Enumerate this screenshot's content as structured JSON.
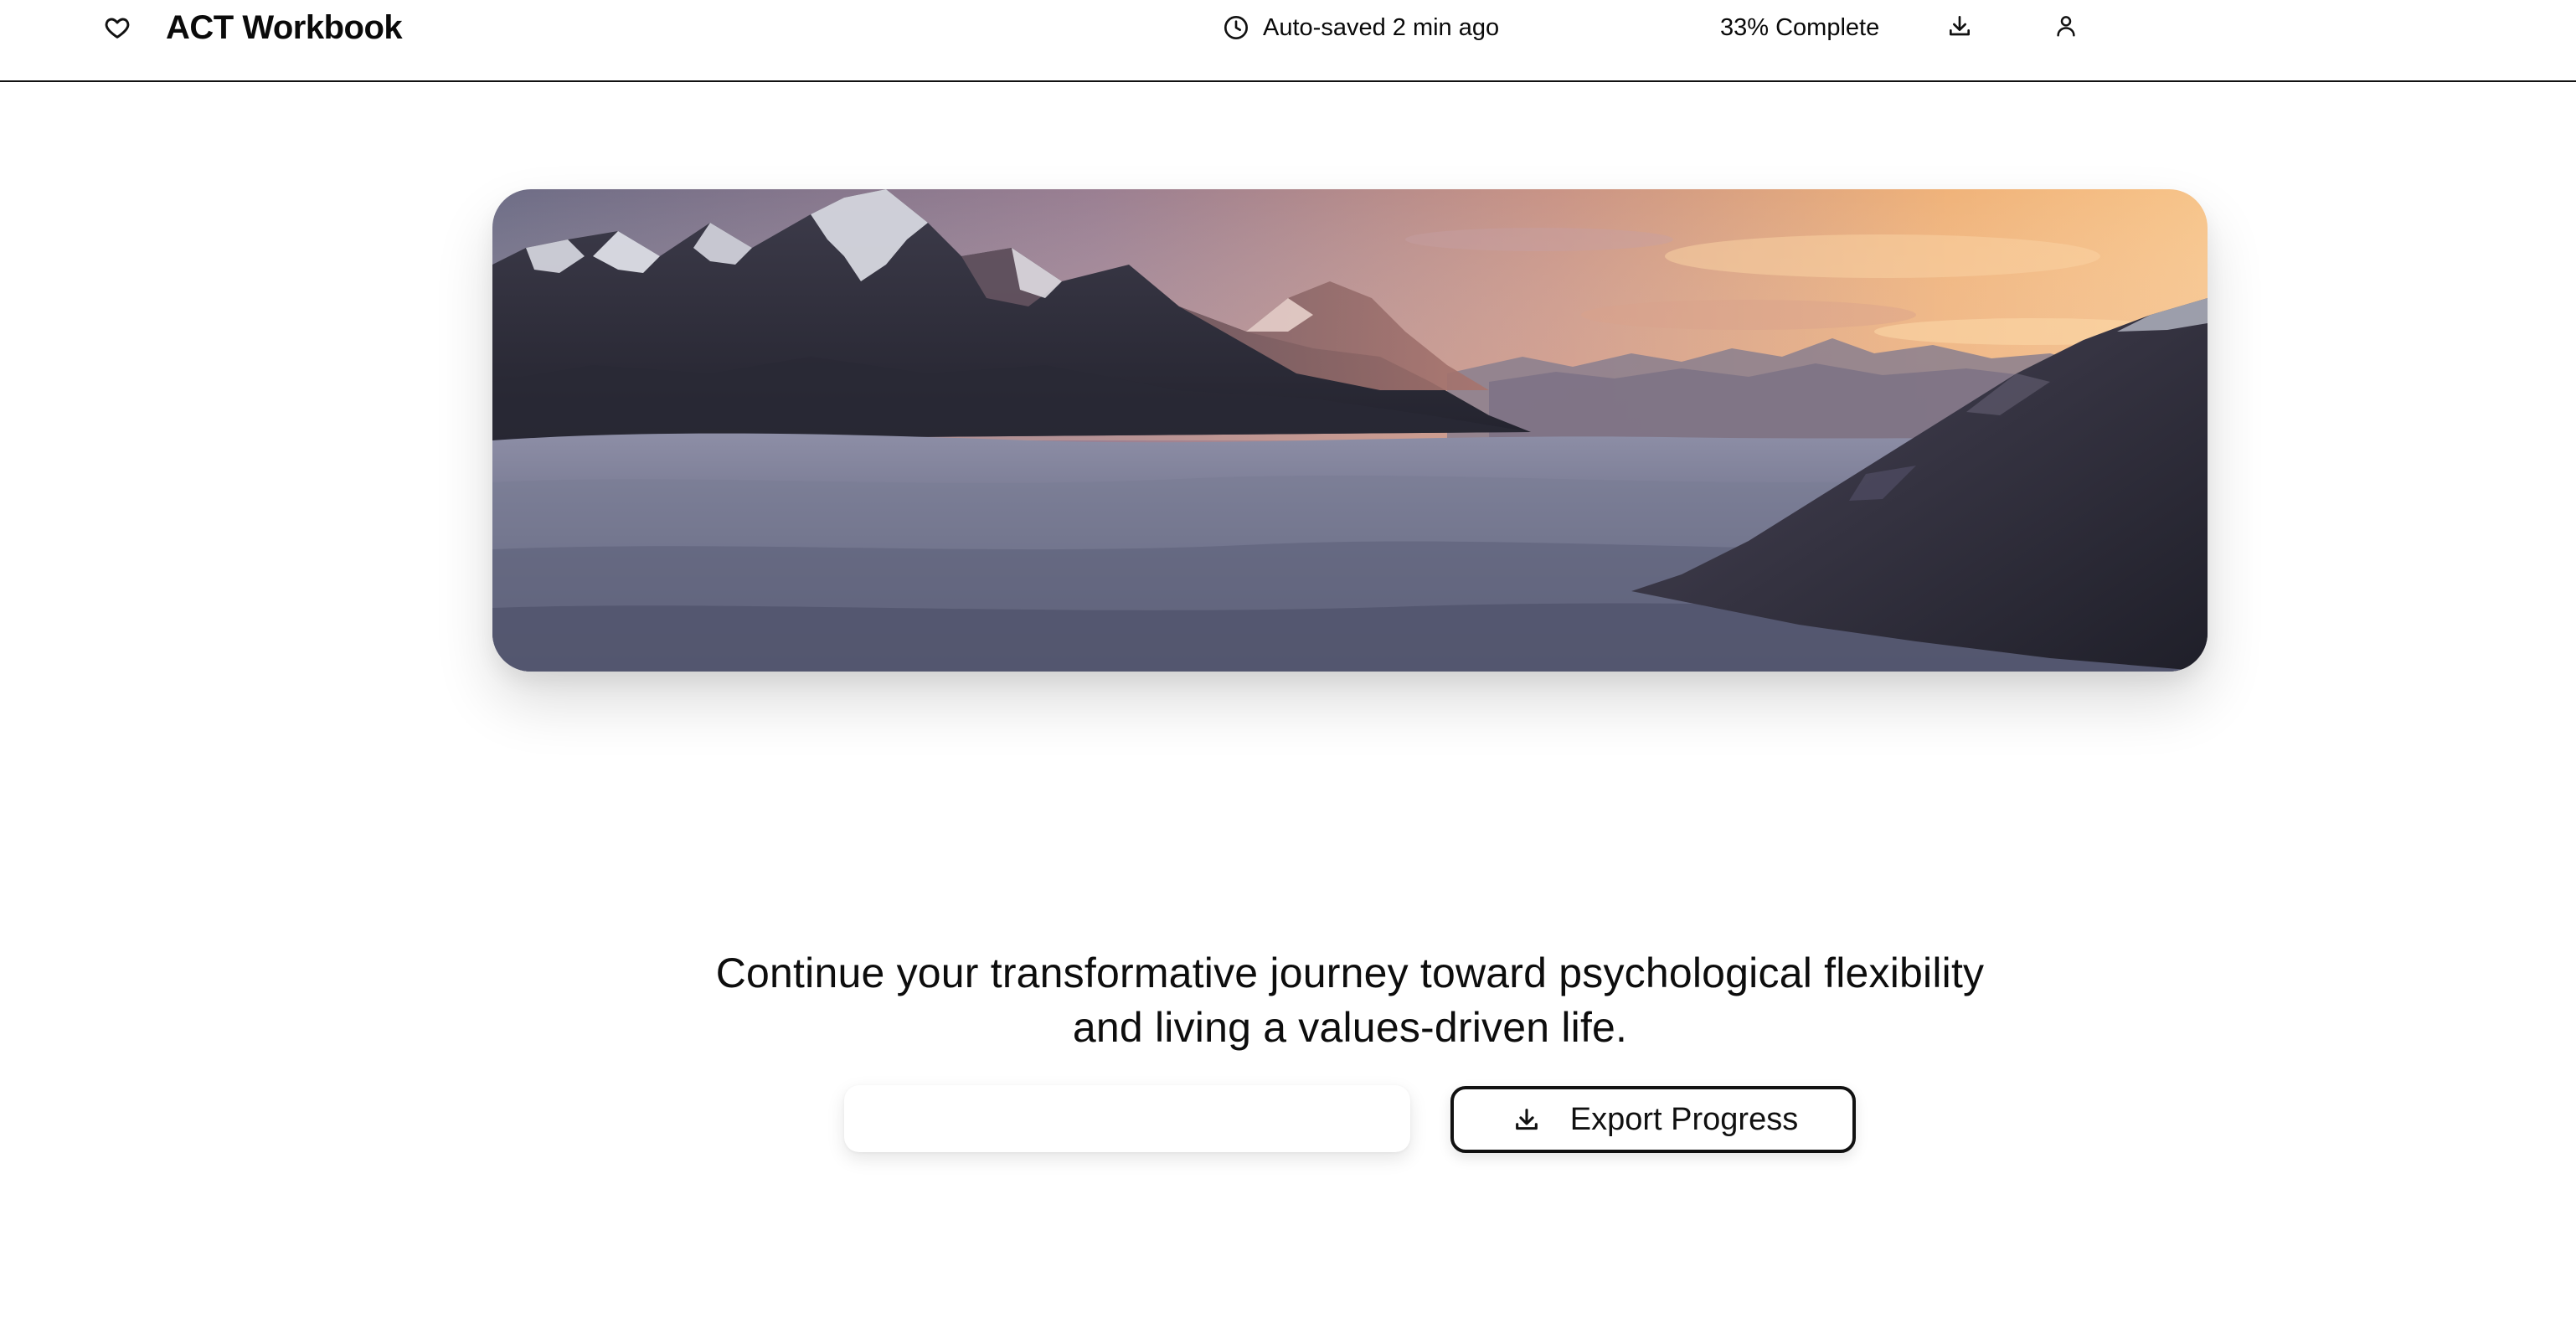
{
  "header": {
    "brand_icon": "heart-icon",
    "title": "ACT Workbook",
    "autosave_icon": "clock-icon",
    "autosave_text": "Auto-saved 2 min ago",
    "progress_text": "33% Complete",
    "download_icon": "download-icon",
    "user_icon": "user-icon"
  },
  "hero": {
    "image_subject": "Mountain range at sunset above a sea of clouds"
  },
  "main": {
    "tagline": "Continue your transformative journey toward psychological flexibility and living a values-driven life.",
    "primary_button_label": "",
    "export_button_label": "Export Progress",
    "export_button_icon": "download-icon"
  },
  "colors": {
    "text": "#0a0a0a",
    "border": "#111111",
    "background": "#ffffff",
    "sky_warm": "#f6b36a",
    "sky_cool": "#7d6f8f",
    "clouds": "#6f7289"
  }
}
